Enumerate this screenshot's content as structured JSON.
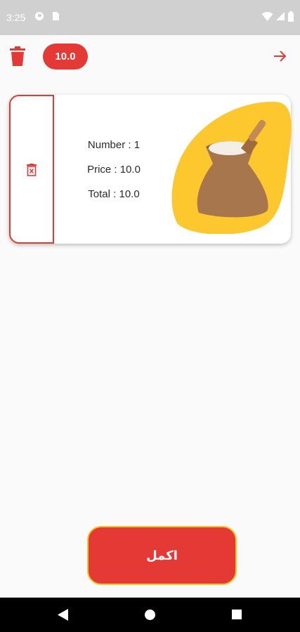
{
  "status_bar": {
    "time": "3:25",
    "icons": [
      "notification-icon",
      "sim-card-icon",
      "wifi-icon",
      "signal-icon",
      "battery-icon"
    ]
  },
  "toolbar": {
    "total_badge": "10.0",
    "icons": {
      "clear_cart": "trash-icon",
      "back": "arrow-right-icon"
    }
  },
  "cart_items": [
    {
      "number_label": "Number : 1",
      "price_label": "Price : 10.0",
      "total_label": "Total : 10.0",
      "image": "rice-sack-image",
      "delete_icon": "delete-icon"
    }
  ],
  "actions": {
    "continue_label": "اكمل"
  },
  "colors": {
    "accent": "#e53935",
    "highlight": "#f5c518",
    "status_bar": "#d0d0d0",
    "background": "#fafafa"
  }
}
